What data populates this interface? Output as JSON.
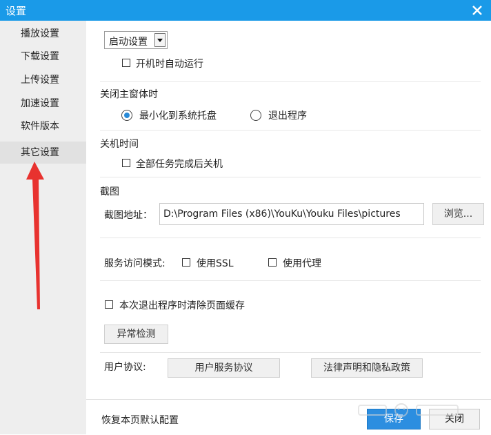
{
  "window": {
    "title": "设置"
  },
  "sidebar": {
    "items": [
      {
        "label": "播放设置"
      },
      {
        "label": "下载设置"
      },
      {
        "label": "上传设置"
      },
      {
        "label": "加速设置"
      },
      {
        "label": "软件版本"
      },
      {
        "label": "其它设置",
        "active": true
      }
    ]
  },
  "startup": {
    "dropdown_value": "启动设置",
    "autorun_label": "开机时自动运行",
    "autorun_checked": false
  },
  "close_main": {
    "heading": "关闭主窗体时",
    "option_minimize": "最小化到系统托盘",
    "option_exit": "退出程序",
    "selected": "minimize"
  },
  "shutdown": {
    "heading": "关机时间",
    "label": "全部任务完成后关机",
    "checked": false
  },
  "screenshot": {
    "heading": "截图",
    "path_label": "截图地址：",
    "path_value": "D:\\Program Files (x86)\\YouKu\\Youku Files\\pictures",
    "browse_label": "浏览..."
  },
  "service": {
    "label": "服务访问模式:",
    "ssl_label": "使用SSL",
    "proxy_label": "使用代理"
  },
  "cache": {
    "clear_label": "本次退出程序时清除页面缓存",
    "detect_label": "异常检测"
  },
  "agreements": {
    "label": "用户协议:",
    "user_service": "用户服务协议",
    "legal_privacy": "法律声明和隐私政策"
  },
  "footer": {
    "restore_label": "恢复本页默认配置",
    "save_label": "保存",
    "close_label": "关闭"
  },
  "colors": {
    "titlebar": "#1a9ae8",
    "accent": "#2c8ee0",
    "annotation_arrow": "#e8322f"
  }
}
